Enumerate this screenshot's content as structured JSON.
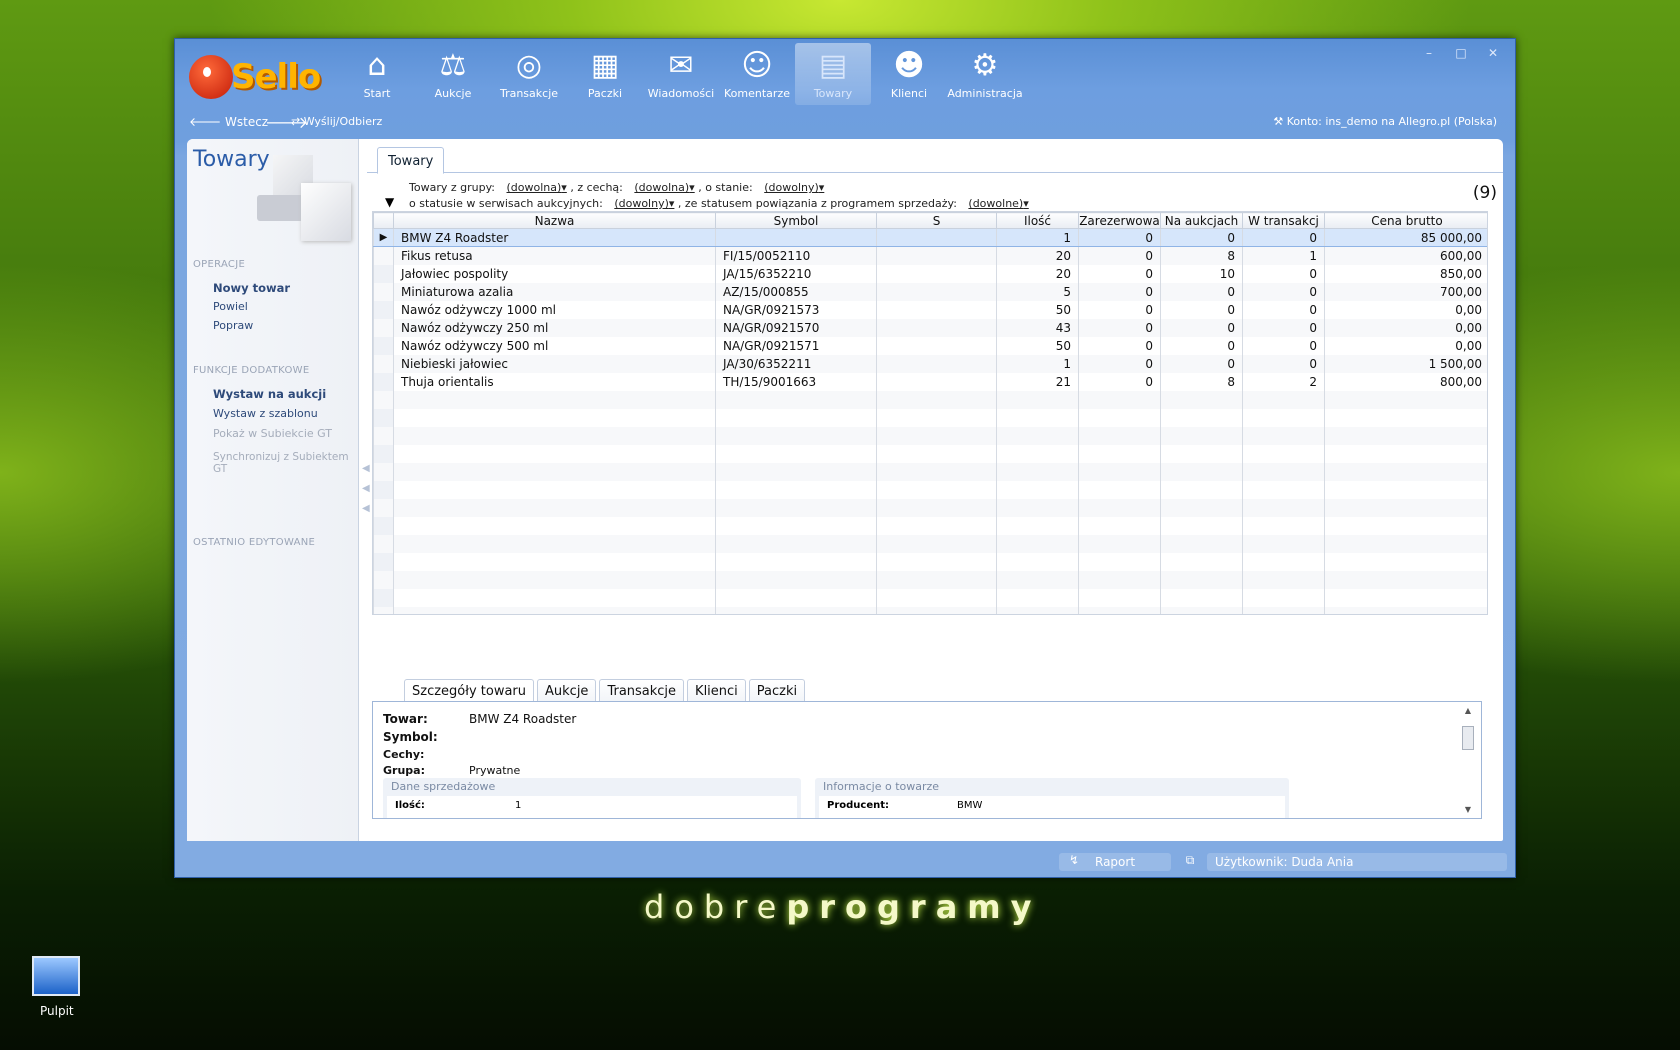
{
  "app": {
    "logo_text": "Sello",
    "window_controls": [
      "–",
      "□",
      "✕"
    ]
  },
  "nav": [
    {
      "label": "Start",
      "icon": "home-icon",
      "glyph": "⌂"
    },
    {
      "label": "Aukcje",
      "icon": "gavel-icon",
      "glyph": "⚖"
    },
    {
      "label": "Transakcje",
      "icon": "transaction-icon",
      "glyph": "◎"
    },
    {
      "label": "Paczki",
      "icon": "package-icon",
      "glyph": "▦"
    },
    {
      "label": "Wiadomości",
      "icon": "messages-icon",
      "glyph": "✉"
    },
    {
      "label": "Komentarze",
      "icon": "comments-icon",
      "glyph": "☺"
    },
    {
      "label": "Towary",
      "icon": "goods-icon",
      "glyph": "▤"
    },
    {
      "label": "Klienci",
      "icon": "clients-icon",
      "glyph": "☻"
    },
    {
      "label": "Administracja",
      "icon": "admin-icon",
      "glyph": "⚙"
    }
  ],
  "toolbar": {
    "back": "Wstecz",
    "send": "Wyślij/Odbierz",
    "account": "Konto: ins_demo na Allegro.pl (Polska)"
  },
  "left": {
    "title": "Towary",
    "sections": [
      {
        "header": "OPERACJE",
        "items": [
          "Nowy towar",
          "Powiel",
          "Popraw"
        ]
      },
      {
        "header": "FUNKCJE DODATKOWE",
        "items": [
          "Wystaw na aukcji",
          "Wystaw z szablonu",
          "Pokaż w Subiekcie GT",
          "Synchronizuj z Subiektem GT"
        ]
      },
      {
        "header": "OSTATNIO EDYTOWANE",
        "items": []
      }
    ]
  },
  "main": {
    "tab": "Towary",
    "count": "(9)",
    "filter": {
      "group_label": "Towary z grupy:",
      "group_value": "(dowolna)",
      "feature_label": ", z cechą:",
      "feature_value": "(dowolna)",
      "state_label": ", o stanie:",
      "state_value": "(dowolny)",
      "auction_label": "o statusie w serwisach aukcyjnych:",
      "auction_value": "(dowolny)",
      "link_label": ", ze statusem powiązania z programem sprzedaży:",
      "link_value": "(dowolne)"
    },
    "columns": [
      "Nazwa",
      "Symbol",
      "S",
      "Ilość",
      "Zarezerwowa",
      "Na aukcjach",
      "W transakcj",
      "Cena brutto"
    ],
    "rows": [
      [
        "BMW Z4 Roadster",
        "",
        "",
        "1",
        "0",
        "0",
        "0",
        "85 000,00"
      ],
      [
        "Fikus retusa",
        "FI/15/0052110",
        "",
        "20",
        "0",
        "8",
        "1",
        "600,00"
      ],
      [
        "Jałowiec pospolity",
        "JA/15/6352210",
        "",
        "20",
        "0",
        "10",
        "0",
        "850,00"
      ],
      [
        "Miniaturowa azalia",
        "AZ/15/000855",
        "",
        "5",
        "0",
        "0",
        "0",
        "700,00"
      ],
      [
        "Nawóz odżywczy 1000 ml",
        "NA/GR/0921573",
        "",
        "50",
        "0",
        "0",
        "0",
        "0,00"
      ],
      [
        "Nawóz odżywczy 250 ml",
        "NA/GR/0921570",
        "",
        "43",
        "0",
        "0",
        "0",
        "0,00"
      ],
      [
        "Nawóz odżywczy 500 ml",
        "NA/GR/0921571",
        "",
        "50",
        "0",
        "0",
        "0",
        "0,00"
      ],
      [
        "Niebieski jałowiec",
        "JA/30/6352211",
        "",
        "1",
        "0",
        "0",
        "0",
        "1 500,00"
      ],
      [
        "Thuja orientalis",
        "TH/15/9001663",
        "",
        "21",
        "0",
        "8",
        "2",
        "800,00"
      ]
    ]
  },
  "bottom_tabs": [
    "Szczegóły towaru",
    "Aukcje",
    "Transakcje",
    "Klienci",
    "Paczki"
  ],
  "details": {
    "towar_label": "Towar:",
    "towar_value": "BMW Z4 Roadster",
    "symbol_label": "Symbol:",
    "symbol_value": "",
    "cechy_label": "Cechy:",
    "cechy_value": "",
    "grupa_label": "Grupa:",
    "grupa_value": "Prywatne",
    "sales_header": "Dane sprzedażowe",
    "sales_qty_label": "Ilość:",
    "sales_qty_value": "1",
    "info_header": "Informacje o towarze",
    "producer_label": "Producent:",
    "producer_value": "BMW"
  },
  "status": {
    "report": "Raport",
    "user": "Użytkownik: Duda Ania"
  },
  "desktop": {
    "brand_light": "dobre",
    "brand_bold": "programy",
    "icon_label": "Pulpit"
  }
}
